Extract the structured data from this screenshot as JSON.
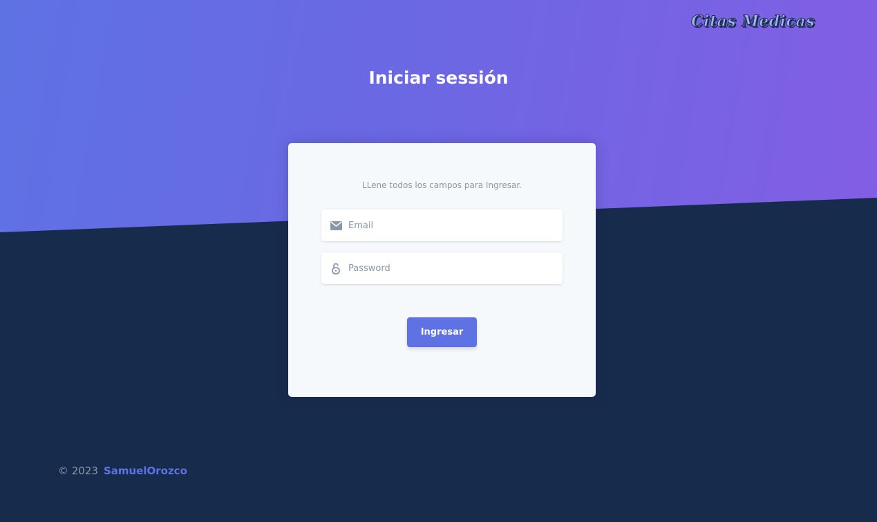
{
  "brand": {
    "name": "Citas Medicas"
  },
  "page": {
    "title": "Iniciar sessión"
  },
  "login_card": {
    "subtitle": "LLene todos los campos para Ingresar.",
    "email": {
      "placeholder": "Email",
      "value": "",
      "icon": "envelope-icon"
    },
    "password": {
      "placeholder": "Password",
      "value": "",
      "icon": "lock-icon"
    },
    "submit_label": "Ingresar"
  },
  "footer": {
    "copyright": "© 2023",
    "author": "SamuelOrozco"
  },
  "colors": {
    "primary": "#5e72e4",
    "gradient_end": "#825ee4",
    "dark_bg": "#172b4d",
    "card_bg": "#f6f9fc",
    "muted_text": "#8898aa"
  }
}
